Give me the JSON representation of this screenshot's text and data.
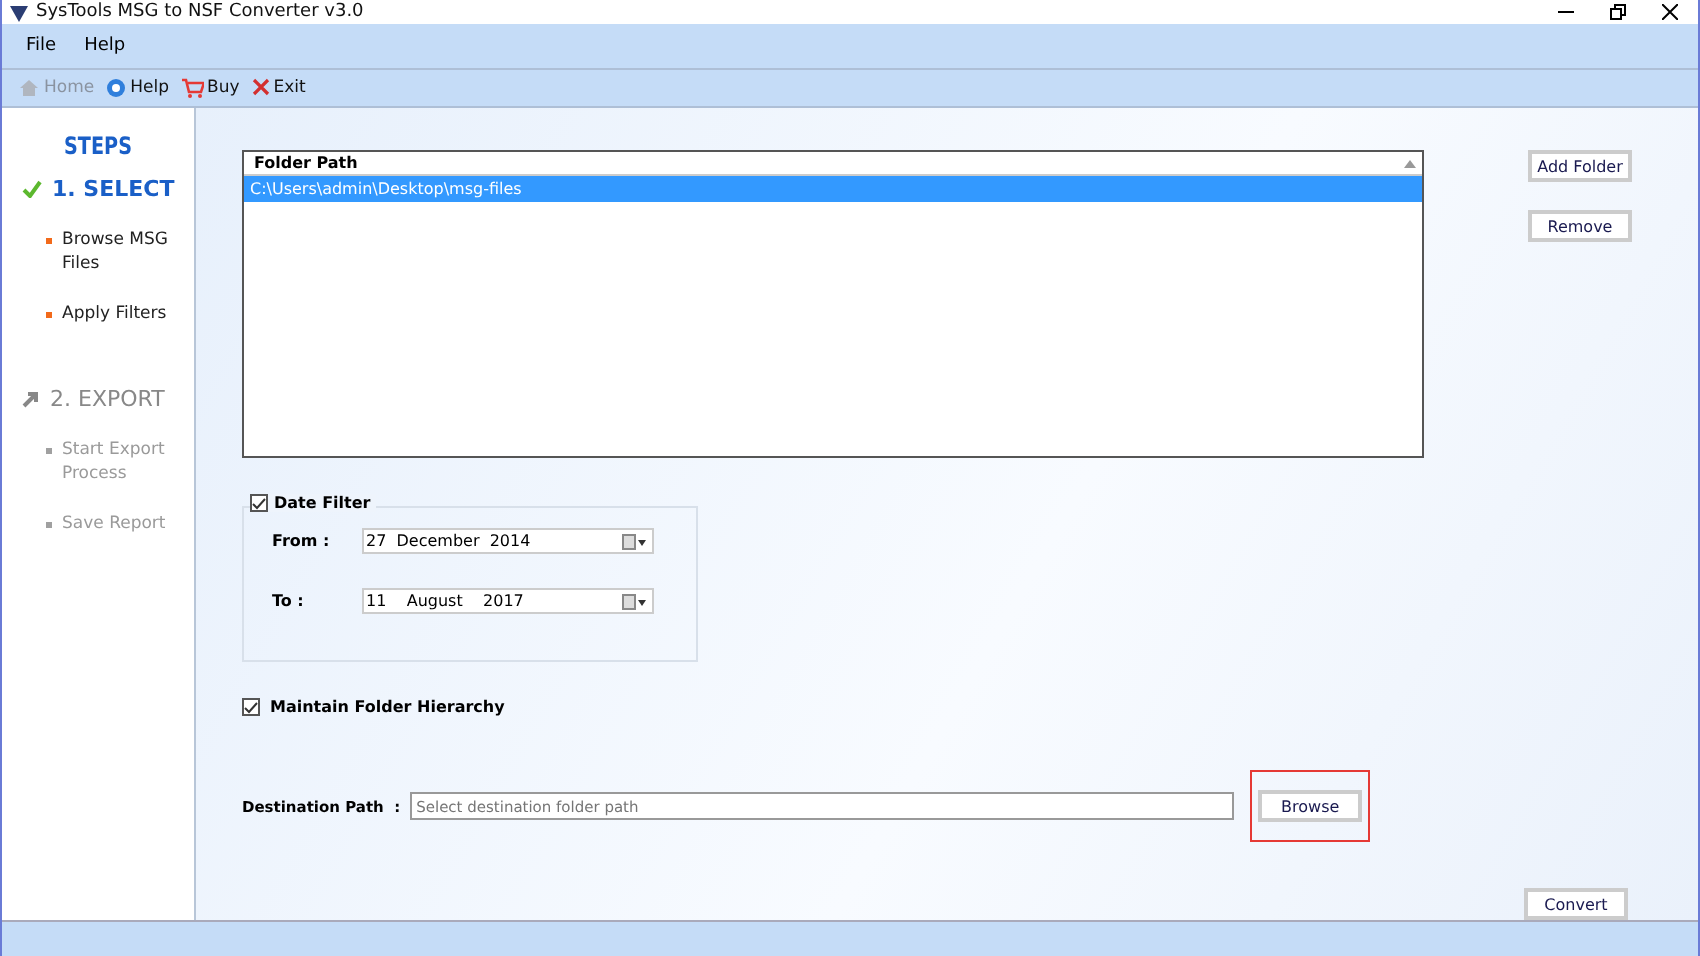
{
  "window": {
    "title": "SysTools MSG to NSF Converter v3.0"
  },
  "menu": [
    "File",
    "Help"
  ],
  "toolbar": [
    {
      "label": "Home",
      "kind": "home",
      "disabled": true
    },
    {
      "label": "Help",
      "kind": "help",
      "disabled": false
    },
    {
      "label": "Buy",
      "kind": "buy",
      "disabled": false
    },
    {
      "label": "Exit",
      "kind": "exit",
      "disabled": false
    }
  ],
  "sidebar": {
    "title": "STEPS",
    "steps": [
      {
        "label": "1. SELECT",
        "active": true,
        "children": [
          "Browse MSG Files",
          "Apply Filters"
        ]
      },
      {
        "label": "2. EXPORT",
        "active": false,
        "children": [
          "Start Export Process",
          "Save Report"
        ]
      }
    ]
  },
  "folder_list": {
    "column": "Folder Path",
    "rows": [
      {
        "text": "C:\\Users\\admin\\Desktop\\msg-files",
        "selected": true
      }
    ]
  },
  "side_buttons": [
    "Add Folder",
    "Remove"
  ],
  "date_filter": {
    "label": "Date Filter",
    "checked": true,
    "from_label": "From :",
    "from": "27  December  2014",
    "to_label": "To :",
    "to": "11    August    2017"
  },
  "hierarchy": {
    "label": "Maintain Folder Hierarchy",
    "checked": true
  },
  "destination": {
    "label": "Destination Path  :",
    "placeholder": "Select destination folder path",
    "button": "Browse",
    "highlighted": true
  },
  "convert_button": "Convert"
}
